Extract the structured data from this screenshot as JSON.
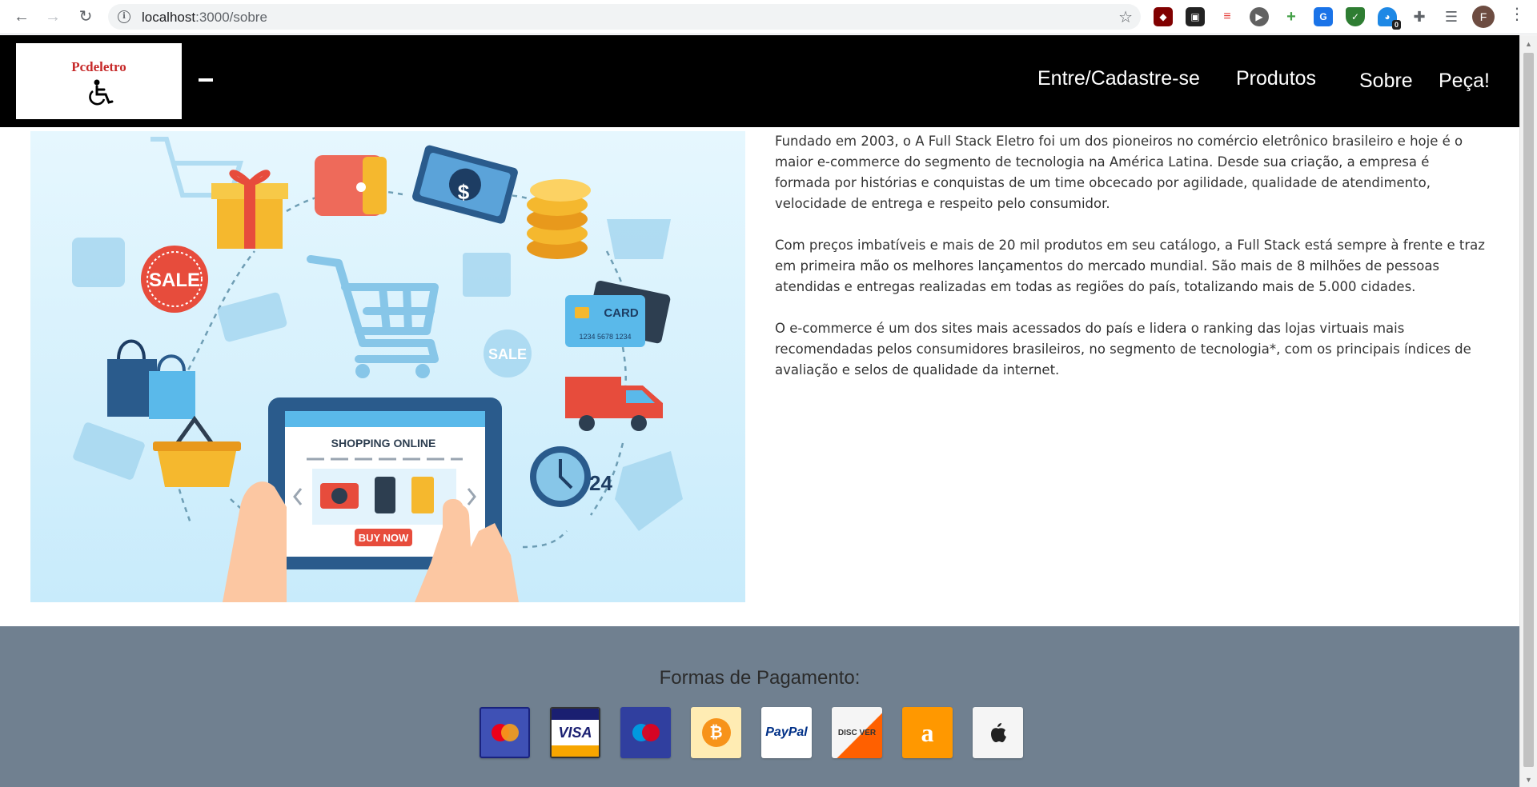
{
  "browser": {
    "url_host": "localhost",
    "url_path": ":3000/sobre",
    "profile_initial": "F",
    "extension_badge": "0"
  },
  "header": {
    "logo_text": "Pcdeletro",
    "nav": [
      "Entre/Cadastre-se",
      "Produtos",
      "Sobre",
      "Peça!"
    ]
  },
  "hero": {
    "screen_title": "SHOPPING ONLINE",
    "buy_button": "BUY NOW",
    "sale_label": "SALE",
    "card_label": "CARD",
    "card_number": "1234 5678 1234",
    "dollar": "$",
    "clock_label": "24"
  },
  "about": {
    "paragraphs": [
      "Fundado em 2003, o A Full Stack Eletro foi um dos pioneiros no comércio eletrônico brasileiro e hoje é o maior e-commerce do segmento de tecnologia na América Latina. Desde sua criação, a empresa é formada por histórias e conquistas de um time obcecado por agilidade, qualidade de atendimento, velocidade de entrega e respeito pelo consumidor.",
      "Com preços imbatíveis e mais de 20 mil produtos em seu catálogo, a Full Stack está sempre à frente e traz em primeira mão os melhores lançamentos do mercado mundial. São mais de 8 milhões de pessoas atendidas e entregas realizadas em todas as regiões do país, totalizando mais de 5.000 cidades.",
      "O e-commerce é um dos sites mais acessados do país e lidera o ranking das lojas virtuais mais recomendadas pelos consumidores brasileiros, no segmento de tecnologia*, com os principais índices de avaliação e selos de qualidade da internet."
    ]
  },
  "footer": {
    "title": "Formas de Pagamento:",
    "payment_methods": [
      {
        "name": "mastercard",
        "label": "",
        "bg": "#3f51b5"
      },
      {
        "name": "visa",
        "label": "VISA",
        "bg": "#ffffff"
      },
      {
        "name": "maestro",
        "label": "",
        "bg": "#303f9f"
      },
      {
        "name": "bitcoin",
        "label": "₿",
        "bg": "#ffecb3"
      },
      {
        "name": "paypal",
        "label": "PayPal",
        "bg": "#ffffff"
      },
      {
        "name": "discover",
        "label": "DISC VER",
        "bg": "#f5f5f5"
      },
      {
        "name": "amazon",
        "label": "a",
        "bg": "#ff9800"
      },
      {
        "name": "apple-pay",
        "label": "",
        "bg": "#f5f5f5"
      }
    ]
  },
  "colors": {
    "header_bg": "#000000",
    "footer_bg": "#708090",
    "logo_red": "#c62828"
  }
}
